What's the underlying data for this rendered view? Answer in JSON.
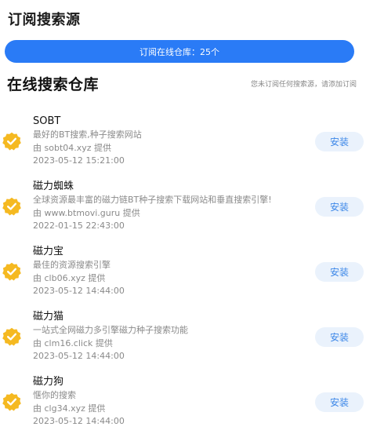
{
  "header": {
    "title": "订阅搜索源"
  },
  "subscribe_bar": {
    "label": "订阅在线仓库：25个"
  },
  "section": {
    "title": "在线搜索仓库",
    "hint": "您未订阅任何搜索源，请添加订阅"
  },
  "colors": {
    "accent": "#2a7bf6",
    "badge": "#f5b921",
    "install_bg": "#eaf2fc",
    "install_text": "#3c87e8"
  },
  "icons": {
    "verified": "verified-badge-icon"
  },
  "repos": [
    {
      "name": "SOBT",
      "desc": "最好的BT搜索,种子搜索网站",
      "provider": "由 sobt04.xyz 提供",
      "date": "2023-05-12 15:21:00",
      "button": "安装"
    },
    {
      "name": "磁力蜘蛛",
      "desc": "全球资源最丰富的磁力链BT种子搜索下载网站和垂直搜索引擎!",
      "provider": "由 www.btmovi.guru 提供",
      "date": "2022-01-15 22:43:00",
      "button": "安装"
    },
    {
      "name": "磁力宝",
      "desc": "最佳的资源搜索引擎",
      "provider": "由 clb06.xyz 提供",
      "date": "2023-05-12 14:44:00",
      "button": "安装"
    },
    {
      "name": "磁力猫",
      "desc": "一站式全网磁力多引擎磁力种子搜索功能",
      "provider": "由 clm16.click 提供",
      "date": "2023-05-12 14:44:00",
      "button": "安装"
    },
    {
      "name": "磁力狗",
      "desc": "惬你的搜索",
      "provider": "由 clg34.xyz 提供",
      "date": "2023-05-12 14:44:00",
      "button": "安装"
    }
  ]
}
